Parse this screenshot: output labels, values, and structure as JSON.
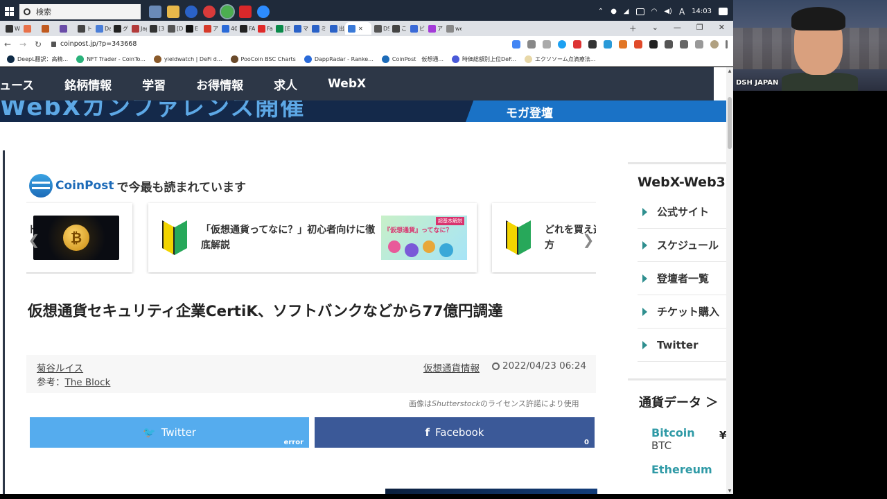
{
  "taskbar": {
    "search_label": "検索",
    "time": "14:03",
    "ime": "A"
  },
  "tabs": [
    {
      "label": "W",
      "color": "#333333"
    },
    {
      "label": "",
      "color": "#e8714a"
    },
    {
      "label": "",
      "color": "#c05a1f"
    },
    {
      "label": "",
      "color": "#6a4ca8"
    },
    {
      "label": "ト",
      "color": "#444444"
    },
    {
      "label": "Da",
      "color": "#4a7ed8"
    },
    {
      "label": "グ",
      "color": "#222222"
    },
    {
      "label": "Jag",
      "color": "#b23a3a"
    },
    {
      "label": "[3]",
      "color": "#333333"
    },
    {
      "label": "[D",
      "color": "#555555"
    },
    {
      "label": "E",
      "color": "#111111"
    },
    {
      "label": "ア",
      "color": "#d63a2a"
    },
    {
      "label": "40",
      "color": "#2a6ad8"
    },
    {
      "label": "FA",
      "color": "#222222"
    },
    {
      "label": "Fa",
      "color": "#e02a2a"
    },
    {
      "label": "[E",
      "color": "#0a8a4a"
    },
    {
      "label": "マ",
      "color": "#2a62c8"
    },
    {
      "label": "ミ",
      "color": "#2a62c8"
    },
    {
      "label": "出",
      "color": "#2a62c8"
    },
    {
      "label": "",
      "color": "#3a7ad8",
      "active": true
    },
    {
      "label": "DS",
      "color": "#555555"
    },
    {
      "label": "こ",
      "color": "#444444"
    },
    {
      "label": "ビ",
      "color": "#3a6ad8"
    },
    {
      "label": "ア",
      "color": "#a43ad8"
    },
    {
      "label": "we",
      "color": "#888888"
    }
  ],
  "address": {
    "url": "coinpost.jp/?p=343668"
  },
  "bookmarks": [
    {
      "label": "DeepL翻訳：高精...",
      "color": "#0f2b46"
    },
    {
      "label": "NFT Trader - CoinTo...",
      "color": "#2ab27b"
    },
    {
      "label": "yieldwatch | DeFi d...",
      "color": "#8a5a2a"
    },
    {
      "label": "PooCoin BSC Charts",
      "color": "#6a4a2a"
    },
    {
      "label": "DappRadar - Ranke...",
      "color": "#2a6ad8"
    },
    {
      "label": "CoinPost　仮想通...",
      "color": "#1d6bb8"
    },
    {
      "label": "時価総額別上位DeF...",
      "color": "#4a5ad8"
    },
    {
      "label": "エクソソーム点滴療法...",
      "color": "#e8d8a8"
    }
  ],
  "site_nav": [
    "ニュース",
    "銘柄情報",
    "学習",
    "お得情報",
    "求人",
    "WebX"
  ],
  "banner": {
    "left_text": "WebXカンファレンス開催",
    "right_text": "モガ登壇"
  },
  "popular": {
    "brand": "CoinPost",
    "suffix": "で今最も読まれています"
  },
  "carousel": {
    "card1_text": "ト",
    "card1_coin": "₿",
    "card2_text": "「仮想通貨ってなに？」初心者向けに徹底解説",
    "card2_thumb_tag": "超基本解説",
    "card2_thumb_text": "『仮想通貨』ってなに？",
    "card3_text": "どれを買え選び方",
    "prev": "❮",
    "next": "❯"
  },
  "article": {
    "title": "仮想通貨セキュリティ企業CertiK、ソフトバンクなどから77億円調達",
    "author": "菊谷ルイス",
    "ref_label": "参考：",
    "ref_link": "The Block",
    "category": "仮想通貨情報",
    "date": "2022/04/23 06:24",
    "credit_prefix": "画像は",
    "credit_source": "Shutterstock",
    "credit_suffix": "のライセンス許諾により使用"
  },
  "share": {
    "twitter_label": "Twitter",
    "twitter_count": "error",
    "facebook_label": "Facebook",
    "facebook_count": "0"
  },
  "sidebar": {
    "title": "WebX-Web3.",
    "items": [
      "公式サイト",
      "スケジュール",
      "登壇者一覧",
      "チケット購入",
      "Twitter"
    ],
    "currency_title": "通貨データ ＞",
    "coins": [
      {
        "name": "Bitcoin",
        "symbol": "BTC",
        "price_prefix": "¥"
      },
      {
        "name": "Ethereum",
        "symbol": "",
        "price_prefix": ""
      }
    ]
  },
  "webcam": {
    "name": "DSH JAPAN"
  }
}
